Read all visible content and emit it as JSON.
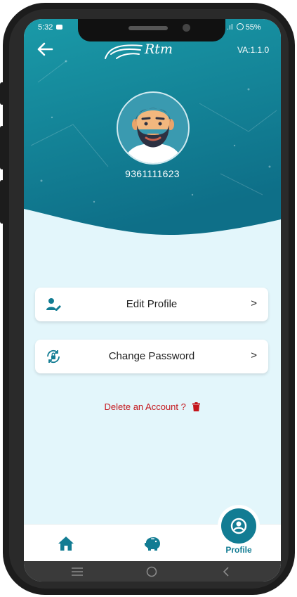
{
  "status_bar": {
    "time": "5:32",
    "battery": "55%"
  },
  "header": {
    "logo_text": "Rtm",
    "version": "VA:1.1.0"
  },
  "profile": {
    "phone": "9361111623"
  },
  "menu": [
    {
      "label": "Edit Profile",
      "icon": "user-edit-icon",
      "chevron": ">"
    },
    {
      "label": "Change Password",
      "icon": "lock-reset-icon",
      "chevron": ">"
    }
  ],
  "delete_account": {
    "label": "Delete an Account ?",
    "icon": "trash-icon"
  },
  "tabs": [
    {
      "icon": "home-icon"
    },
    {
      "icon": "piggy-bank-icon"
    },
    {
      "icon": "profile-icon",
      "label": "Profile",
      "active": true
    }
  ],
  "system_nav": {
    "icons": [
      "menu-icon",
      "home-circle-icon",
      "back-chevron-icon"
    ]
  },
  "colors": {
    "primary": "#127c93",
    "hero_top": "#1a9aa8",
    "hero_bottom": "#0e6f88",
    "background": "#e3f6fb",
    "danger": "#c4161c"
  }
}
